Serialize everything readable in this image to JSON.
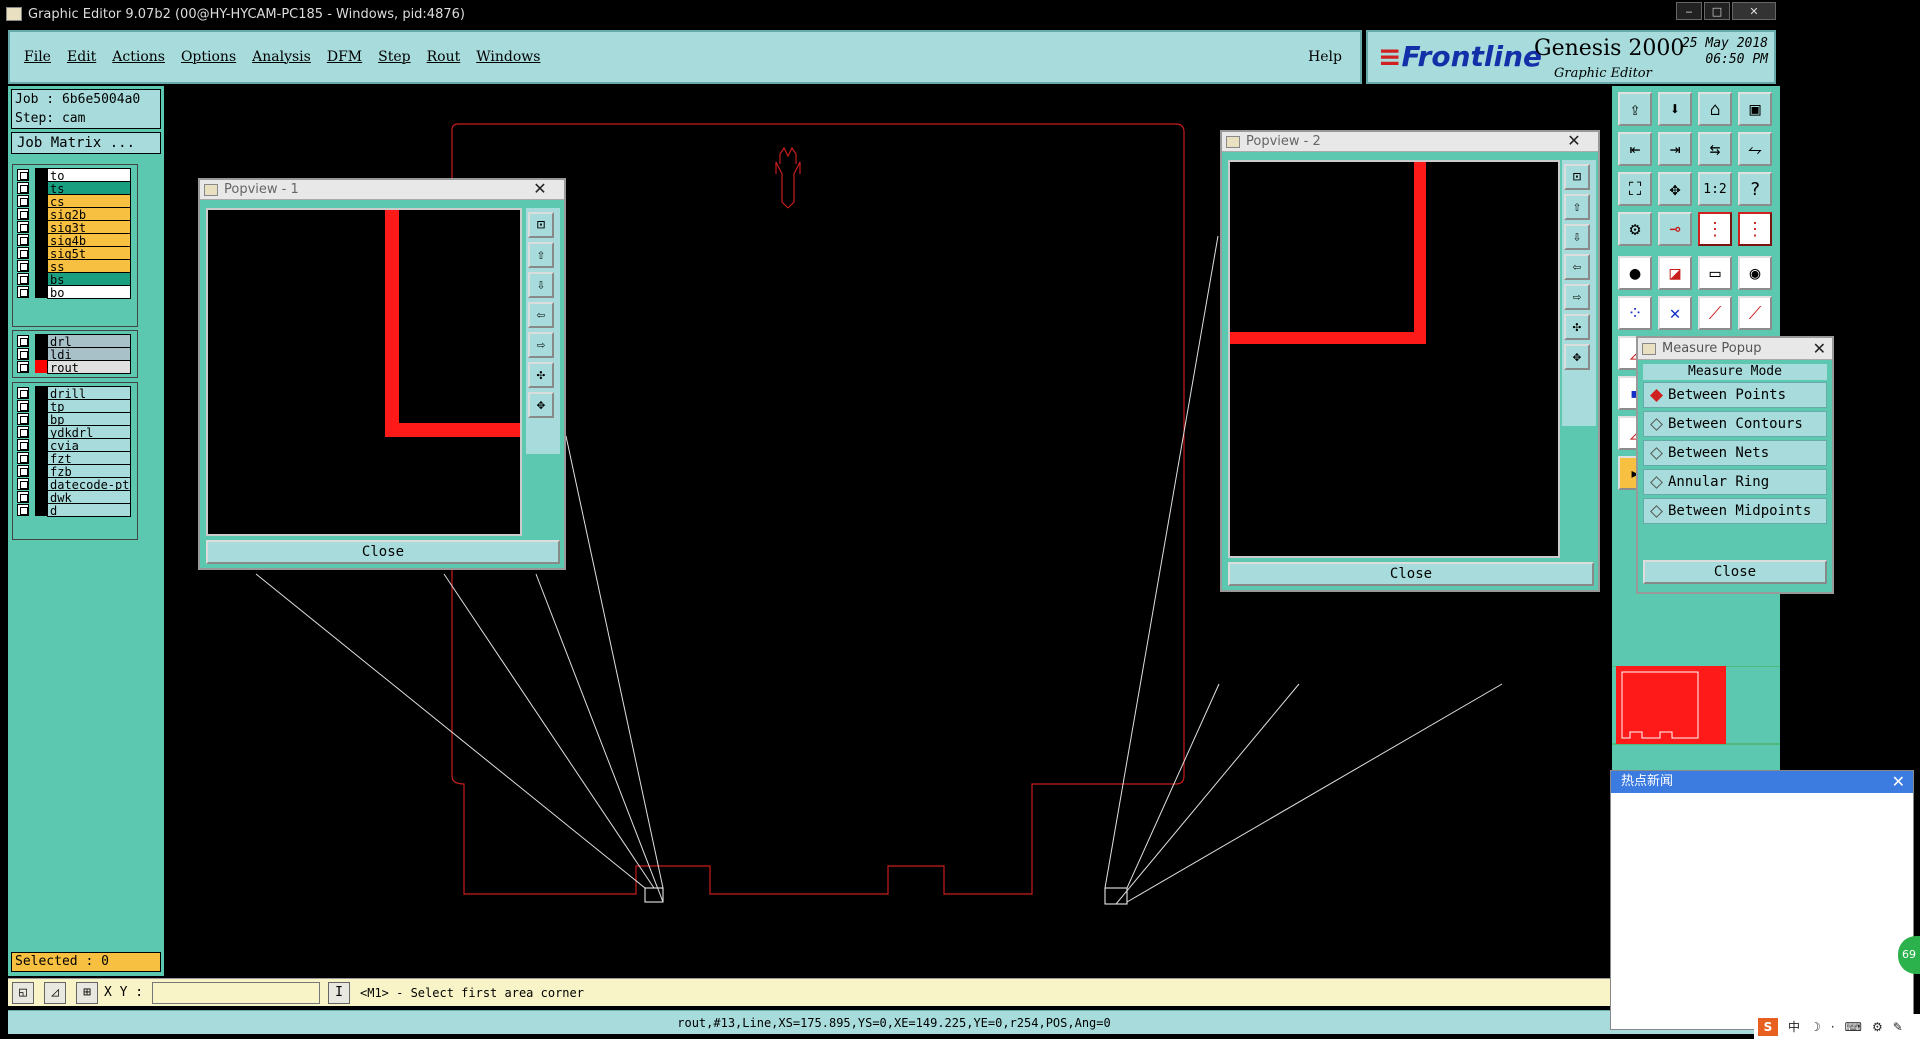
{
  "window": {
    "title": "Graphic Editor 9.07b2 (00@HY-HYCAM-PC185 - Windows, pid:4876)",
    "min_label": "‒",
    "max_label": "□",
    "close_label": "✕"
  },
  "menu": {
    "items": [
      "File",
      "Edit",
      "Actions",
      "Options",
      "Analysis",
      "DFM",
      "Step",
      "Rout",
      "Windows"
    ],
    "help": "Help"
  },
  "brand": {
    "logo_prefix": "≡",
    "logo": "Frontline",
    "product": "Genesis 2000",
    "subtitle": "Graphic Editor",
    "date": "25 May 2018",
    "time": "06:50 PM"
  },
  "job": {
    "job_line": "Job : 6b6e5004a0",
    "step_line": "Step: cam",
    "matrix_button": "Job Matrix ..."
  },
  "layers": {
    "board": [
      {
        "name": "to",
        "color": "#ffffff",
        "swatch": "#000000"
      },
      {
        "name": "ts",
        "color": "#1aa080",
        "swatch": "#000000"
      },
      {
        "name": "cs",
        "color": "#f8c040",
        "swatch": "#000000"
      },
      {
        "name": "sig2b",
        "color": "#f8c040",
        "swatch": "#000000"
      },
      {
        "name": "sig3t",
        "color": "#f8c040",
        "swatch": "#000000"
      },
      {
        "name": "sig4b",
        "color": "#f8c040",
        "swatch": "#000000"
      },
      {
        "name": "sig5t",
        "color": "#f8c040",
        "swatch": "#000000"
      },
      {
        "name": "ss",
        "color": "#f8c040",
        "swatch": "#000000"
      },
      {
        "name": "bs",
        "color": "#1aa080",
        "swatch": "#000000"
      },
      {
        "name": "bo",
        "color": "#ffffff",
        "swatch": "#000000"
      }
    ],
    "drill": [
      {
        "name": "drl",
        "color": "#a8c0c8",
        "swatch": "#000000"
      },
      {
        "name": "ldi",
        "color": "#a8c0c8",
        "swatch": "#000000"
      },
      {
        "name": "rout",
        "color": "#e0e0e0",
        "swatch": "#ff0000"
      }
    ],
    "misc": [
      {
        "name": "drill",
        "color": "#a8dcdc",
        "swatch": "#000000"
      },
      {
        "name": "tp",
        "color": "#a8dcdc",
        "swatch": "#000000"
      },
      {
        "name": "bp",
        "color": "#a8dcdc",
        "swatch": "#000000"
      },
      {
        "name": "ydkdrl",
        "color": "#a8dcdc",
        "swatch": "#000000"
      },
      {
        "name": "cvia",
        "color": "#a8dcdc",
        "swatch": "#000000"
      },
      {
        "name": "fzt",
        "color": "#a8dcdc",
        "swatch": "#000000"
      },
      {
        "name": "fzb",
        "color": "#a8dcdc",
        "swatch": "#000000"
      },
      {
        "name": "datecode-pte",
        "color": "#a8dcdc",
        "swatch": "#000000"
      },
      {
        "name": "dwk",
        "color": "#a8dcdc",
        "swatch": "#000000"
      },
      {
        "name": "d",
        "color": "#a8dcdc",
        "swatch": "#000000"
      }
    ],
    "selected": "Selected : 0"
  },
  "popview1": {
    "title": "Popview - 1",
    "close": "Close",
    "close_x": "✕"
  },
  "popview2": {
    "title": "Popview - 2",
    "close": "Close",
    "close_x": "✕"
  },
  "measure": {
    "title": "Measure Popup",
    "close_x": "✕",
    "mode_label": "Measure Mode",
    "options": [
      "Between Points",
      "Between Contours",
      "Between Nets",
      "Annular Ring",
      "Between Midpoints"
    ],
    "selected_option": "Between Points",
    "close": "Close"
  },
  "command": {
    "xy_label": "X Y :",
    "xy_value": "",
    "message": "<M1> - Select first area corner"
  },
  "status": "rout,#13,Line,XS=175.895,YS=0,XE=149.225,YE=0,r254,POS,Ang=0",
  "news": {
    "title": "热点新闻",
    "close_x": "✕"
  },
  "tray": {
    "ime_label": "S",
    "ime_mode": "中",
    "badge": "69"
  },
  "colors": {
    "panel": "#5cc8b0",
    "button": "#a8dcdc",
    "trace": "#ff0000",
    "outline": "#c81e1e"
  }
}
